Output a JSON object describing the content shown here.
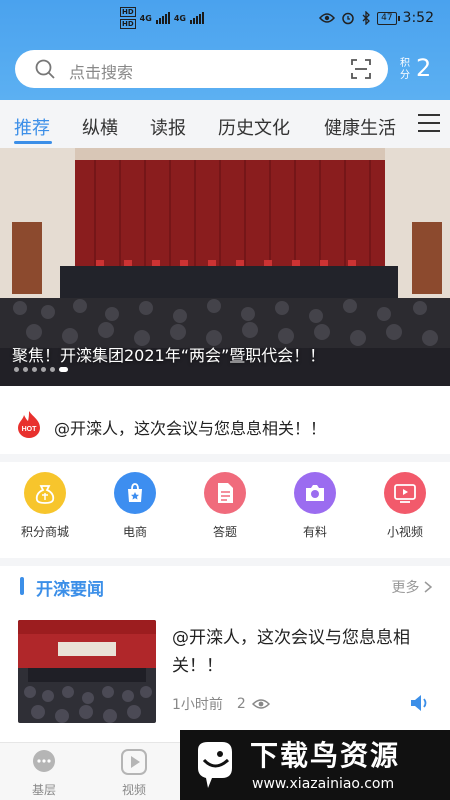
{
  "statusbar": {
    "hd1": "HD",
    "hd2": "HD",
    "net1": "4G",
    "net2": "4G",
    "battery": "47",
    "time": "3:52"
  },
  "search": {
    "placeholder": "点击搜索"
  },
  "points": {
    "label": "积分",
    "value": "2"
  },
  "tabs": [
    {
      "label": "推荐"
    },
    {
      "label": "纵横"
    },
    {
      "label": "读报"
    },
    {
      "label": "历史文化"
    },
    {
      "label": "健康生活"
    }
  ],
  "banner": {
    "caption": "聚焦！开滦集团2021年“两会”暨职代会！！"
  },
  "hot": {
    "badge": "HOT",
    "text": "@开滦人，这次会议与您息息相关！！"
  },
  "features": [
    {
      "label": "积分商城",
      "color": "#f7c52c",
      "icon": "money-bag-icon"
    },
    {
      "label": "电商",
      "color": "#3d8ef0",
      "icon": "shopping-bag-icon"
    },
    {
      "label": "答题",
      "color": "#f06b7c",
      "icon": "document-icon"
    },
    {
      "label": "有料",
      "color": "#9b6cf0",
      "icon": "camera-icon"
    },
    {
      "label": "小视频",
      "color": "#f25a6b",
      "icon": "video-icon"
    }
  ],
  "section": {
    "title": "开滦要闻",
    "more": "更多"
  },
  "news": {
    "title": "@开滦人，这次会议与您息息相关！！",
    "time": "1小时前",
    "views": "2"
  },
  "bottom_nav": [
    {
      "label": "基层",
      "icon": "chat-icon"
    },
    {
      "label": "视频",
      "icon": "play-icon"
    }
  ],
  "watermark": {
    "title": "下载鸟资源",
    "url": "www.xiazainiao.com"
  }
}
